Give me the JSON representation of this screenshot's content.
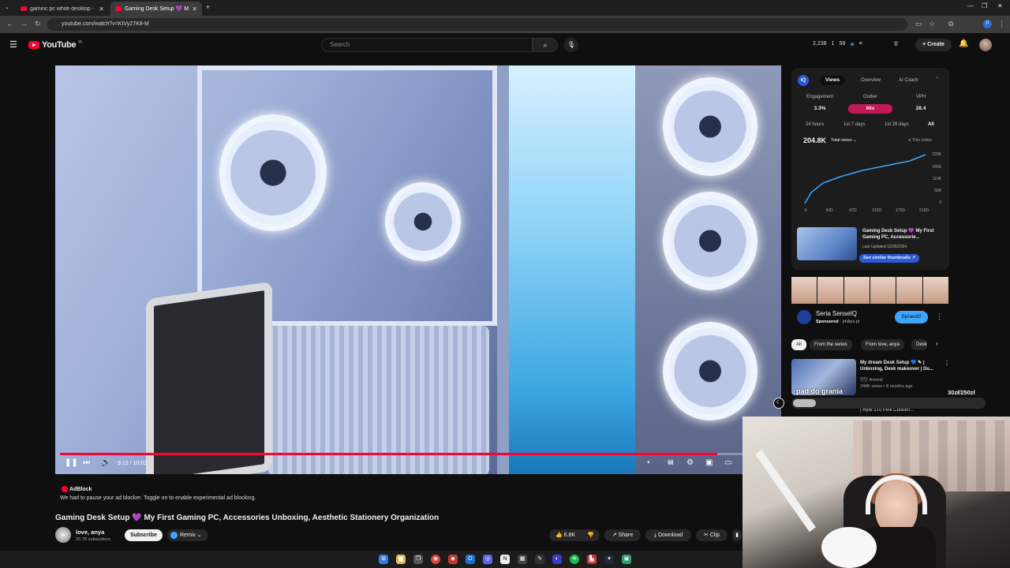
{
  "browser": {
    "tabs": [
      {
        "title": "gaminc pc white desktop - YouTu..."
      },
      {
        "title": "Gaming Desk Setup 💜 My..."
      }
    ],
    "url": "youtube.com/watch?v=KIVy27K8-M"
  },
  "masthead": {
    "logo_text": "YouTube",
    "region": "PL",
    "search_placeholder": "Search",
    "stats": [
      "2,238",
      "1",
      "58"
    ],
    "create_label": "Create"
  },
  "player": {
    "time": "9:12 / 10:02",
    "progress": 0.917
  },
  "adblock": {
    "title": "AdBlock",
    "message": "We had to pause your ad blocker. Toggle on to enable experimental ad blocking."
  },
  "video": {
    "title": "Gaming Desk Setup 💜 My First Gaming PC, Accessories Unboxing, Aesthetic Stationery Organization",
    "channel": "love, anya",
    "subscribers": "26.7K subscribers",
    "subscribe_label": "Subscribe",
    "remix_label": "Remix",
    "likes": "6.8K",
    "share_label": "Share",
    "download_label": "Download",
    "clip_label": "Clip"
  },
  "vidiq": {
    "tabs": [
      "Views",
      "Overview",
      "AI Coach"
    ],
    "metrics": [
      {
        "label": "Engagement",
        "value": "3.3%"
      },
      {
        "label": "Outlier",
        "value": "66x"
      },
      {
        "label": "VPH",
        "value": "28.4"
      }
    ],
    "ranges": [
      "24 hours",
      "1st 7 days",
      "1st 28 days",
      "All"
    ],
    "total": "204.8K",
    "total_label": "Total views",
    "legend": "This video",
    "y_ticks": [
      "220K",
      "165K",
      "110K",
      "55K",
      "0"
    ],
    "x_ticks": [
      "0",
      "43D",
      "87D",
      "131D",
      "175D",
      "219D"
    ],
    "related_title": "Gaming Desk Setup 💜 My First Gaming PC, Accessorie...",
    "related_meta": "Last Updated 12/26/2024",
    "similar_label": "See similar thumbnails"
  },
  "sponsor": {
    "name": "Seria SenseIQ",
    "meta_bold": "Sponsored",
    "meta": "philips.pl",
    "cta": "Sprawdź"
  },
  "chips": [
    "All",
    "From the series",
    "From love, anya",
    "Desk"
  ],
  "recommendation": {
    "title": "My dream Desk Setup 💙 ✎ | Unboxing, Desk makeover | Du...",
    "channel": "만민 Annmir",
    "meta": "248K views • 8 months ago",
    "next_title": "| Ryte 170 Pink Custom..."
  },
  "overlay": {
    "label": "pad do grania",
    "amount": "30zł/250zł",
    "progress": 0.12
  },
  "colors": {
    "accent": "#ff0033",
    "vidiq_blue": "#3ea6ff",
    "outlier": "#c2185b"
  }
}
